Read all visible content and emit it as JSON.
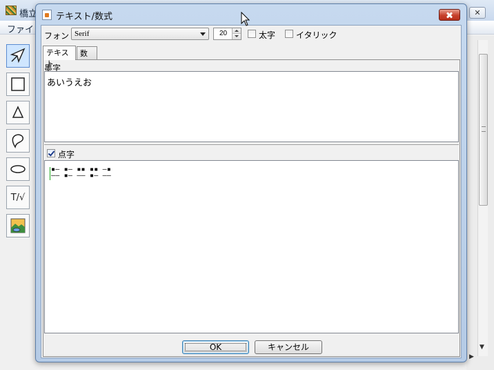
{
  "background_window": {
    "title": "橋立",
    "close_glyph": "✕",
    "menu_file": "ファイノ",
    "toolbar": {
      "tools": [
        {
          "name": "select-arrow-icon"
        },
        {
          "name": "rectangle-icon"
        },
        {
          "name": "triangle-icon"
        },
        {
          "name": "freeform-icon"
        },
        {
          "name": "ellipse-icon"
        },
        {
          "name": "text-math-icon",
          "label": "T/√"
        },
        {
          "name": "image-icon"
        }
      ]
    },
    "scroll_down_glyph": "▼",
    "scroll_right_glyph": "▶"
  },
  "dialog": {
    "title": "テキスト/数式",
    "font_label": "フォント",
    "font_value": "Serif",
    "size_value": "20",
    "bold_label": "太字",
    "bold_checked": false,
    "italic_label": "イタリック",
    "italic_checked": false,
    "tabs": [
      {
        "label": "テキスト",
        "active": true
      },
      {
        "label": "数式",
        "active": false
      }
    ],
    "ink": {
      "label": "墨字",
      "text": "あいうえお"
    },
    "braille": {
      "label": "点字",
      "checked": true,
      "line1": "▪‒ ▪‒ ▪▪ ▪▪ ‒▪",
      "line2": "‒‒ ▪‒ ‒‒ ▪‒ ‒‒"
    },
    "ok_label": "OK",
    "cancel_label": "キャンセル"
  },
  "colors": {
    "dialog_frame": "#b5cbe6",
    "close_button": "#c7402c",
    "caret": "#22aa22"
  }
}
